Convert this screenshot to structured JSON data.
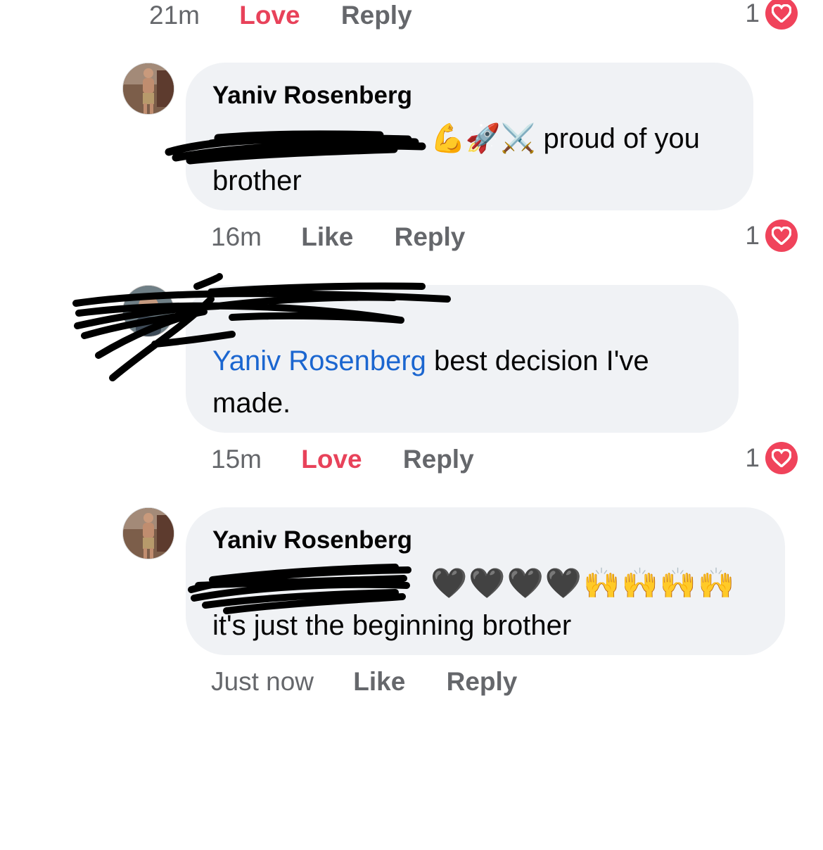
{
  "comments": [
    {
      "time": "21m",
      "action": "Love",
      "reply": "Reply",
      "reaction_count": "1"
    },
    {
      "author": "Yaniv Rosenberg",
      "text_after_mention": "💪🚀⚔️ proud of you",
      "text_line2": "brother",
      "time": "16m",
      "action": "Like",
      "reply": "Reply",
      "reaction_count": "1"
    },
    {
      "mention": "Yaniv Rosenberg",
      "text": " best decision I've",
      "text_line2": "made.",
      "time": "15m",
      "action": "Love",
      "reply": "Reply",
      "reaction_count": "1"
    },
    {
      "author": "Yaniv Rosenberg",
      "emojis": "🖤🖤🖤🖤🙌🙌🙌🙌",
      "text_line2": "it's just the beginning brother",
      "time": "Just now",
      "action": "Like",
      "reply": "Reply"
    }
  ],
  "colors": {
    "love": "#e8425a",
    "mention": "#1b66d0",
    "bubble": "#f0f2f5",
    "meta": "#65676b",
    "heart": "#f0435b"
  },
  "icons": {
    "reaction": "heart-icon",
    "avatar": "user-avatar"
  }
}
